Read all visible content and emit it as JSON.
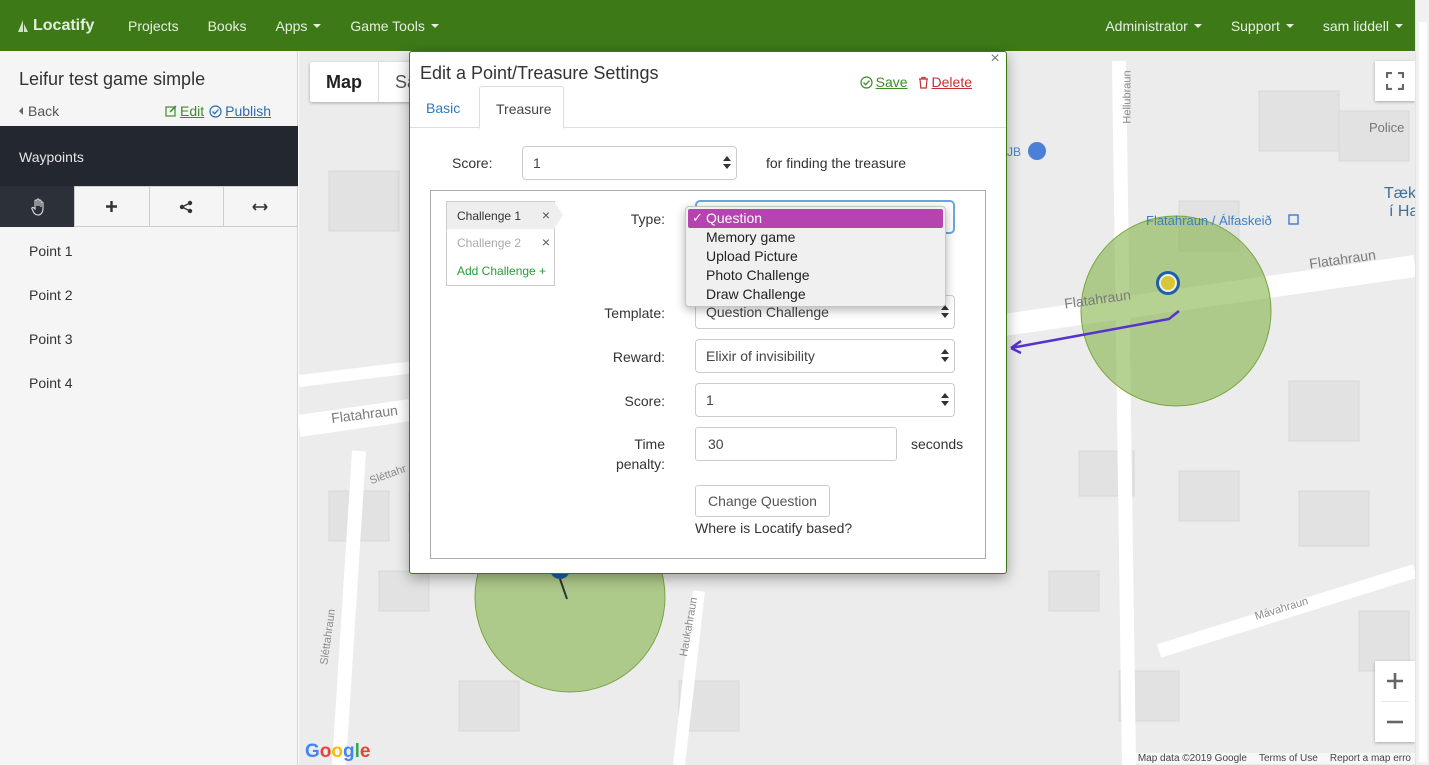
{
  "nav": {
    "brand": "Locatify",
    "items": [
      {
        "label": "Projects",
        "caret": false
      },
      {
        "label": "Books",
        "caret": false
      },
      {
        "label": "Apps",
        "caret": true
      },
      {
        "label": "Game Tools",
        "caret": true
      }
    ],
    "right": [
      {
        "label": "Administrator"
      },
      {
        "label": "Support"
      },
      {
        "label": "sam liddell"
      }
    ],
    "color": "#3d7a17"
  },
  "sidebar": {
    "title": "Leifur test game simple",
    "back": "Back",
    "edit": "Edit",
    "publish": "Publish",
    "section": "Waypoints",
    "tools": [
      "hand-icon",
      "plus-icon",
      "share-icon",
      "arrows-horizontal-icon"
    ],
    "points": [
      "Point 1",
      "Point 2",
      "Point 3",
      "Point 4"
    ]
  },
  "map": {
    "toggle_map": "Map",
    "toggle_sat": "Sa",
    "labels": {
      "flatahraun": "Flatahraun",
      "hellubraun": "Hellubraun",
      "haukahraun": "Haukahraun",
      "slettahraun": "Sléttahraun",
      "slettahr2": "Sléttahr",
      "mavahraun": "Mávahraun",
      "police": "Police",
      "taek": "Tæk",
      "iha": "í Ha",
      "jb": "JB",
      "bus": "Flatahraun / Álfaskeið"
    },
    "google": "Google",
    "footer": [
      "Map data ©2019 Google",
      "Terms of Use",
      "Report a map erro"
    ]
  },
  "modal": {
    "title": "Edit a Point/Treasure Settings",
    "save": "Save",
    "delete": "Delete",
    "close": "×",
    "tabs": {
      "basic": "Basic",
      "treasure": "Treasure"
    },
    "score_label": "Score:",
    "score_value": "1",
    "score_suffix": "for finding the treasure",
    "challenges": {
      "items": [
        "Challenge 1",
        "Challenge 2"
      ],
      "add": "Add Challenge +",
      "remove": "×"
    },
    "type_label": "Type:",
    "type_options": [
      "Question",
      "Memory game",
      "Upload Picture",
      "Photo Challenge",
      "Draw Challenge"
    ],
    "type_selected": "Question",
    "template_label": "Template:",
    "template_value": "Question Challenge",
    "reward_label": "Reward:",
    "reward_value": "Elixir of invisibility",
    "ch_score_label": "Score:",
    "ch_score_value": "1",
    "penalty_label_1": "Time",
    "penalty_label_2": "penalty:",
    "penalty_value": "30",
    "penalty_unit": "seconds",
    "change_question": "Change Question",
    "question_text": "Where is Locatify based?"
  }
}
